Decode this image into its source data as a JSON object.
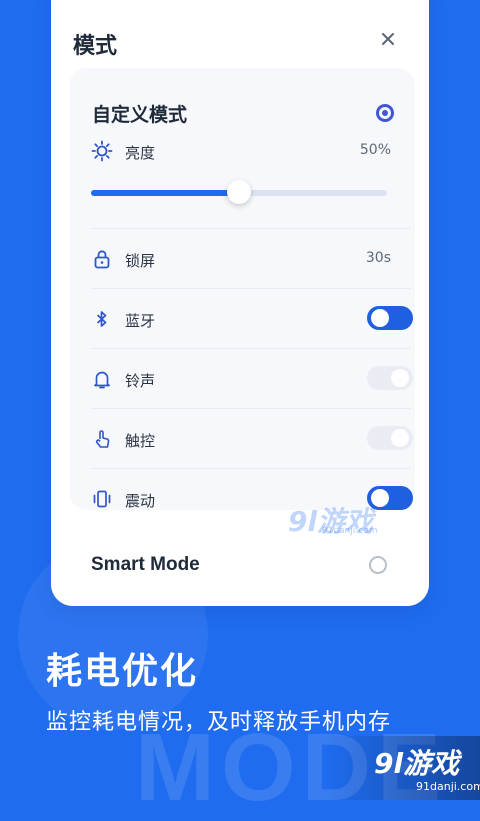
{
  "dialog": {
    "title": "模式",
    "close_icon": "close-icon"
  },
  "custom_mode": {
    "title": "自定义模式",
    "selected": true,
    "brightness": {
      "label": "亮度",
      "value": "50%",
      "level": 0.5
    },
    "rows": [
      {
        "key": "lock",
        "icon": "lock-icon",
        "label": "锁屏",
        "value": "30s"
      },
      {
        "key": "bluetooth",
        "icon": "bluetooth-icon",
        "label": "蓝牙",
        "toggle": true
      },
      {
        "key": "ringtone",
        "icon": "bell-icon",
        "label": "铃声",
        "toggle": false
      },
      {
        "key": "touch",
        "icon": "touch-icon",
        "label": "触控",
        "toggle": false
      },
      {
        "key": "vibrate",
        "icon": "vibrate-icon",
        "label": "震动",
        "toggle": true
      }
    ]
  },
  "smart_mode": {
    "title": "Smart Mode",
    "selected": false
  },
  "promo": {
    "headline": "耗电优化",
    "subline": "监控耗电情况，及时释放手机内存",
    "bg_word": "MODE"
  },
  "watermark": {
    "big": "9l游戏",
    "small": "91danji.com"
  },
  "colors": {
    "accent": "#1f6cf0",
    "radio": "#3f57d6",
    "toggle_on": "#1f5fe0"
  }
}
